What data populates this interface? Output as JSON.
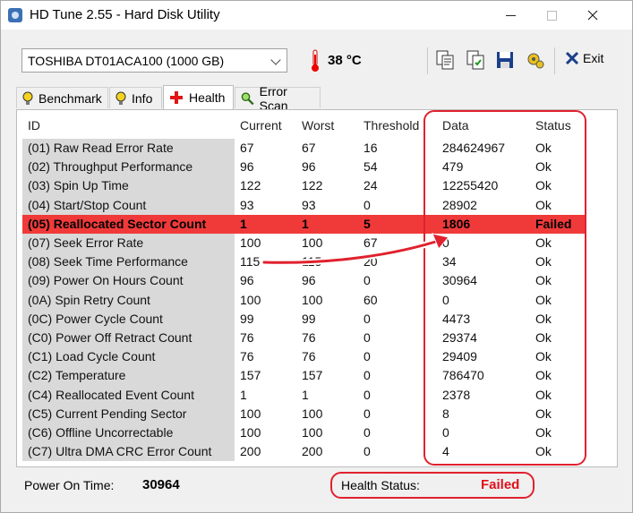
{
  "window": {
    "title": "HD Tune 2.55 - Hard Disk Utility"
  },
  "toolbar": {
    "drive": "TOSHIBA DT01ACA100 (1000 GB)",
    "temperature": "38 °C",
    "exit_label": "Exit"
  },
  "tabs": [
    {
      "label": "Benchmark",
      "icon": "lightbulb-icon"
    },
    {
      "label": "Info",
      "icon": "lightbulb-icon"
    },
    {
      "label": "Health",
      "icon": "red-cross-icon",
      "active": true
    },
    {
      "label": "Error Scan",
      "icon": "magnifier-icon"
    }
  ],
  "table": {
    "headers": [
      "ID",
      "Current",
      "Worst",
      "Threshold",
      "Data",
      "Status"
    ],
    "rows": [
      {
        "id": "(01) Raw Read Error Rate",
        "current": "67",
        "worst": "67",
        "threshold": "16",
        "data": "284624967",
        "status": "Ok"
      },
      {
        "id": "(02) Throughput Performance",
        "current": "96",
        "worst": "96",
        "threshold": "54",
        "data": "479",
        "status": "Ok"
      },
      {
        "id": "(03) Spin Up Time",
        "current": "122",
        "worst": "122",
        "threshold": "24",
        "data": "12255420",
        "status": "Ok"
      },
      {
        "id": "(04) Start/Stop Count",
        "current": "93",
        "worst": "93",
        "threshold": "0",
        "data": "28902",
        "status": "Ok"
      },
      {
        "id": "(05) Reallocated Sector Count",
        "current": "1",
        "worst": "1",
        "threshold": "5",
        "data": "1806",
        "status": "Failed",
        "failed": true
      },
      {
        "id": "(07) Seek Error Rate",
        "current": "100",
        "worst": "100",
        "threshold": "67",
        "data": "0",
        "status": "Ok"
      },
      {
        "id": "(08) Seek Time Performance",
        "current": "115",
        "worst": "115",
        "threshold": "20",
        "data": "34",
        "status": "Ok"
      },
      {
        "id": "(09) Power On Hours Count",
        "current": "96",
        "worst": "96",
        "threshold": "0",
        "data": "30964",
        "status": "Ok"
      },
      {
        "id": "(0A) Spin Retry Count",
        "current": "100",
        "worst": "100",
        "threshold": "60",
        "data": "0",
        "status": "Ok"
      },
      {
        "id": "(0C) Power Cycle Count",
        "current": "99",
        "worst": "99",
        "threshold": "0",
        "data": "4473",
        "status": "Ok"
      },
      {
        "id": "(C0) Power Off Retract Count",
        "current": "76",
        "worst": "76",
        "threshold": "0",
        "data": "29374",
        "status": "Ok"
      },
      {
        "id": "(C1) Load Cycle Count",
        "current": "76",
        "worst": "76",
        "threshold": "0",
        "data": "29409",
        "status": "Ok"
      },
      {
        "id": "(C2) Temperature",
        "current": "157",
        "worst": "157",
        "threshold": "0",
        "data": "786470",
        "status": "Ok"
      },
      {
        "id": "(C4) Reallocated Event Count",
        "current": "1",
        "worst": "1",
        "threshold": "0",
        "data": "2378",
        "status": "Ok"
      },
      {
        "id": "(C5) Current Pending Sector",
        "current": "100",
        "worst": "100",
        "threshold": "0",
        "data": "8",
        "status": "Ok"
      },
      {
        "id": "(C6) Offline Uncorrectable",
        "current": "100",
        "worst": "100",
        "threshold": "0",
        "data": "0",
        "status": "Ok"
      },
      {
        "id": "(C7) Ultra DMA CRC Error Count",
        "current": "200",
        "worst": "200",
        "threshold": "0",
        "data": "4",
        "status": "Ok"
      }
    ]
  },
  "status": {
    "power_on_label": "Power On Time:",
    "power_on_value": "30964",
    "health_label": "Health Status:",
    "health_value": "Failed"
  },
  "colors": {
    "failed_row": "#f03a3a",
    "annotation": "#e0212e"
  }
}
